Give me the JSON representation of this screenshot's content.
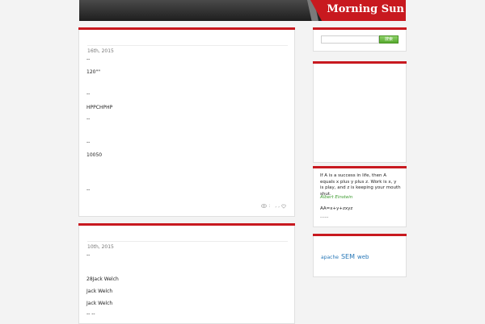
{
  "header": {
    "title": "Morning Sun"
  },
  "posts": [
    {
      "date": "16th, 2015",
      "lines": [
        "--",
        "120\"\"",
        "--",
        "HPPCHPHP",
        "--",
        "--",
        "10050",
        "--"
      ],
      "meta": {
        "views": ":",
        "comments": ", ,"
      }
    },
    {
      "date": "10th, 2015",
      "lines": [
        "--",
        "28Jack Welch",
        "Jack Welch",
        "Jack Welch",
        "-- --"
      ]
    }
  ],
  "search": {
    "placeholder": "",
    "button_label": "搜索"
  },
  "quote": {
    "text": "If A is a success in life, then A equals x plus y plus z. Work is x, y is play, and z is keeping your mouth shut.",
    "author": "Albert Einstein",
    "formula": "AA=x+y+zxyz",
    "more": "......"
  },
  "tags": [
    "apache",
    "SEM",
    "web"
  ]
}
